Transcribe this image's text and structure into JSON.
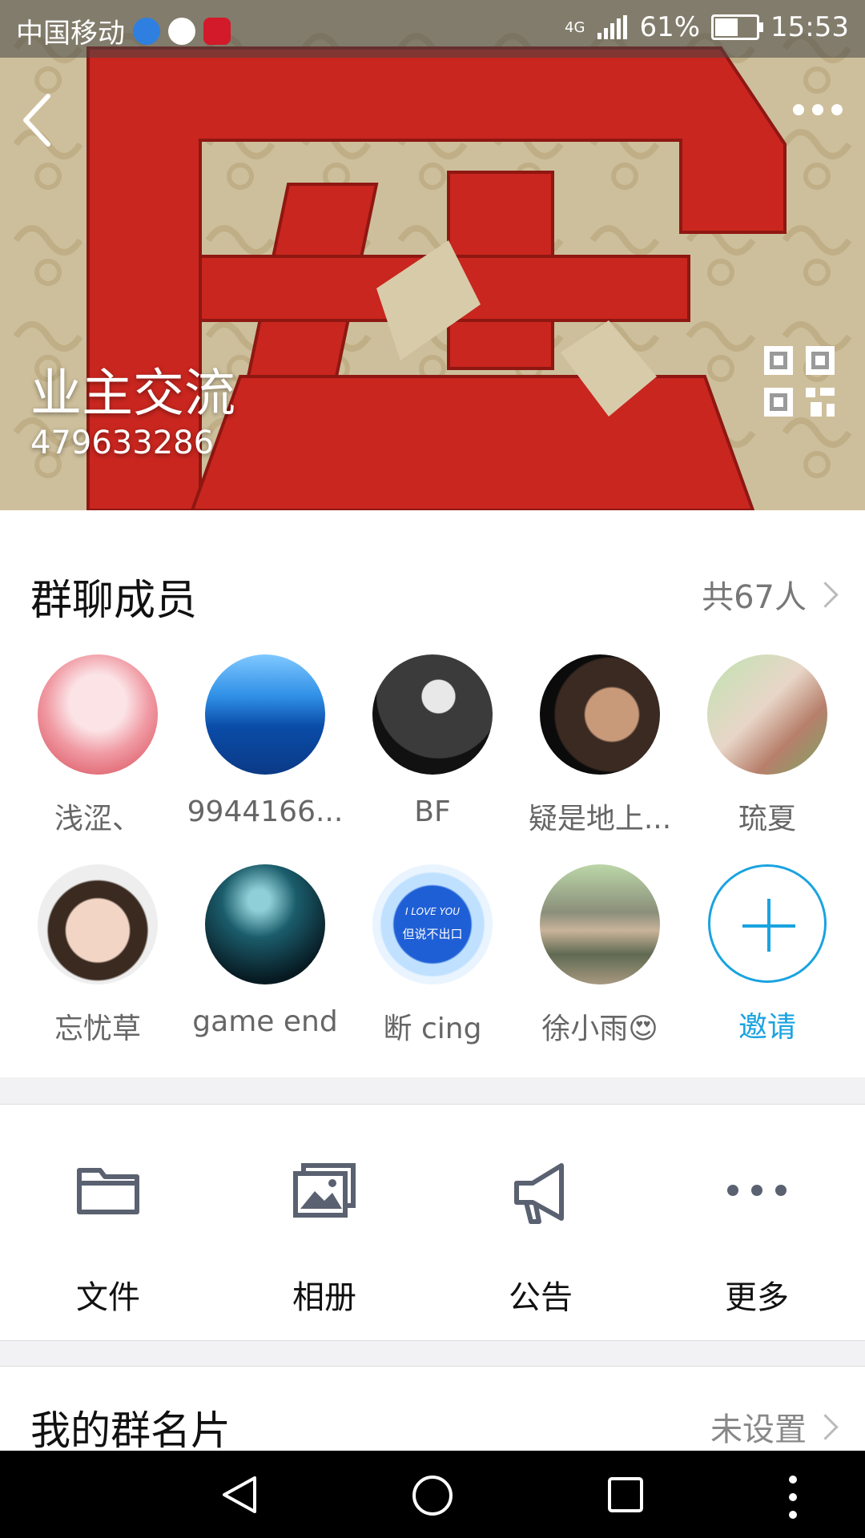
{
  "status_bar": {
    "carrier": "中国移动",
    "network": "4G",
    "battery_percent": "61%",
    "battery_level": 0.61,
    "time": "15:53"
  },
  "header": {
    "group_name": "业主交流",
    "group_id": "479633286"
  },
  "members_section": {
    "title": "群聊成员",
    "count_label": "共67人",
    "members": [
      {
        "name": "浅涩、"
      },
      {
        "name": "9944166..."
      },
      {
        "name": "BF"
      },
      {
        "name": "疑是地上..."
      },
      {
        "name": "琉夏"
      },
      {
        "name": "忘忧草"
      },
      {
        "name": "game end"
      },
      {
        "name": "断 cing"
      },
      {
        "name": "徐小雨😍"
      }
    ],
    "invite_label": "邀请",
    "avatar_heart_text_1": "I LOVE YOU",
    "avatar_heart_text_2": "但说不出口"
  },
  "tools": {
    "files": "文件",
    "album": "相册",
    "notice": "公告",
    "more": "更多"
  },
  "card": {
    "title": "我的群名片",
    "value": "未设置"
  },
  "colors": {
    "accent": "#1aa3e0",
    "banner_red": "#c8261f",
    "icon_gray": "#5a6170"
  }
}
